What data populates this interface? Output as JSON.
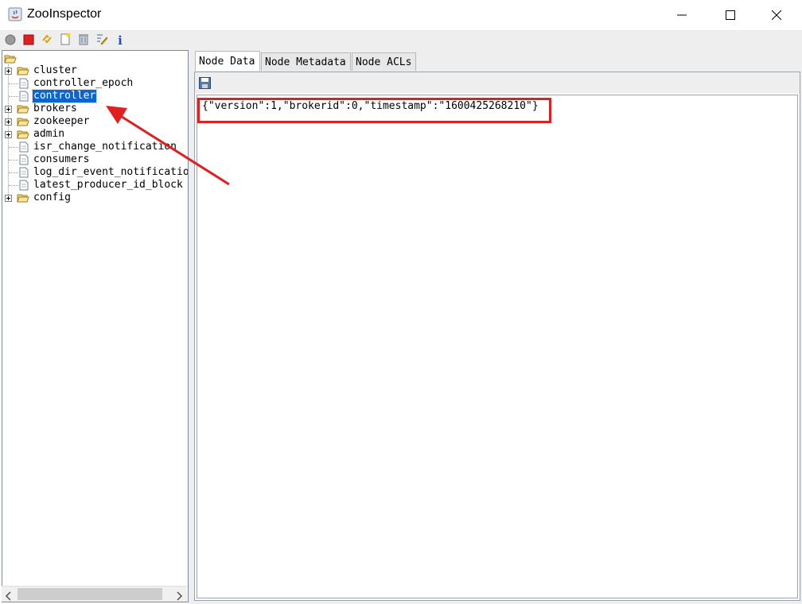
{
  "window": {
    "title": "ZooInspector",
    "controls": [
      "minimize",
      "maximize",
      "close"
    ]
  },
  "toolbar": {
    "buttons": [
      {
        "name": "connect-icon"
      },
      {
        "name": "disconnect-icon"
      },
      {
        "name": "refresh-icon"
      },
      {
        "name": "add-node-icon"
      },
      {
        "name": "delete-node-icon"
      },
      {
        "name": "edit-icon"
      },
      {
        "name": "info-icon",
        "glyph": "i"
      }
    ]
  },
  "tree": {
    "nodes": [
      {
        "label": "cluster",
        "type": "folder"
      },
      {
        "label": "controller_epoch",
        "type": "leaf"
      },
      {
        "label": "controller",
        "type": "leaf",
        "selected": true
      },
      {
        "label": "brokers",
        "type": "folder"
      },
      {
        "label": "zookeeper",
        "type": "folder"
      },
      {
        "label": "admin",
        "type": "folder"
      },
      {
        "label": "isr_change_notification",
        "type": "leaf"
      },
      {
        "label": "consumers",
        "type": "leaf"
      },
      {
        "label": "log_dir_event_notification",
        "type": "leaf"
      },
      {
        "label": "latest_producer_id_block",
        "type": "leaf"
      },
      {
        "label": "config",
        "type": "folder"
      }
    ]
  },
  "tabs": [
    {
      "label": "Node Data",
      "active": true
    },
    {
      "label": "Node Metadata",
      "active": false
    },
    {
      "label": "Node ACLs",
      "active": false
    }
  ],
  "node_data": {
    "text": "{\"version\":1,\"brokerid\":0,\"timestamp\":\"1600425268210\"}"
  },
  "colors": {
    "selection": "#0a64d2",
    "annotation": "#e02020"
  }
}
